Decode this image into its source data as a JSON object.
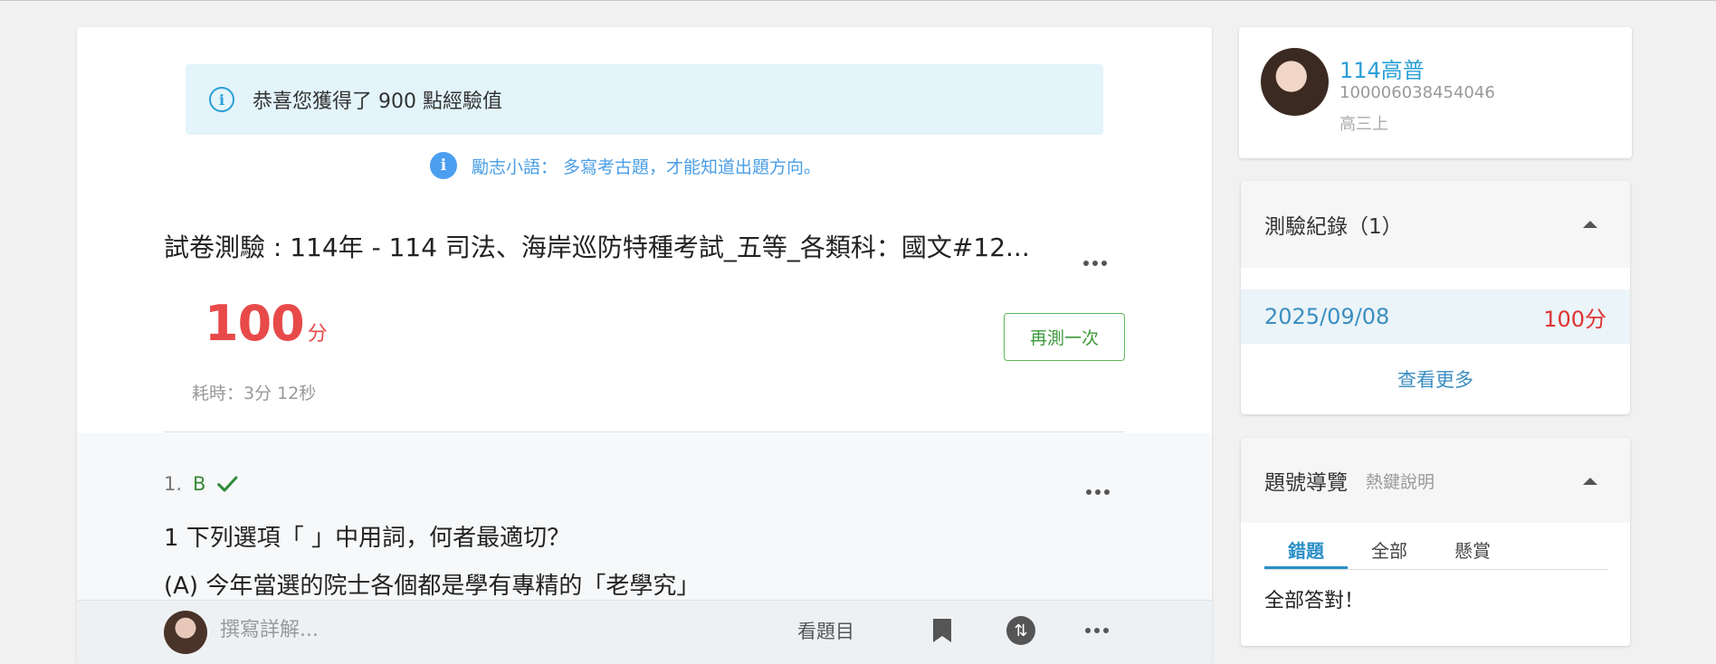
{
  "alert": {
    "text": "恭喜您獲得了 900 點經驗值",
    "icon": "info-icon"
  },
  "motto": {
    "text": "勵志小語： 多寫考古題，才能知道出題方向。",
    "icon": "info-icon"
  },
  "exam": {
    "title": "試卷測驗 : 114年 - 114 司法、海岸巡防特種考試_五等_各類科：國文#12..."
  },
  "result": {
    "score": "100",
    "score_unit": "分",
    "time_used": "耗時：3分 12秒",
    "retry_label": "再測一次"
  },
  "question": {
    "number": "1.",
    "answer": "B",
    "correct": true,
    "text": "1 下列選項「 」中用詞，何者最適切？",
    "option_a": "(A) 今年當選的院士各個都是學有專精的「老學究」"
  },
  "bottom_bar": {
    "placeholder": "撰寫詳解...",
    "view_question": "看題目",
    "icons": [
      "avatar",
      "bookmark-icon",
      "share-icon",
      "more-icon"
    ]
  },
  "user": {
    "name": "114高普",
    "id": "100006038454046",
    "grade": "高三上"
  },
  "records": {
    "title": "測驗紀錄（1）",
    "items": [
      {
        "date": "2025/09/08",
        "score": "100分"
      }
    ],
    "more_label": "查看更多"
  },
  "navigator": {
    "title": "題號導覽",
    "hint": "熱鍵說明",
    "tabs": [
      "錯題",
      "全部",
      "懸賞"
    ],
    "active_tab": "錯題",
    "empty_text": "全部答對！"
  },
  "colors": {
    "accent_blue": "#2a9fd6",
    "score_red": "#e84a4a",
    "correct_green": "#3a8a3a",
    "alert_bg": "#e3f4fb"
  }
}
